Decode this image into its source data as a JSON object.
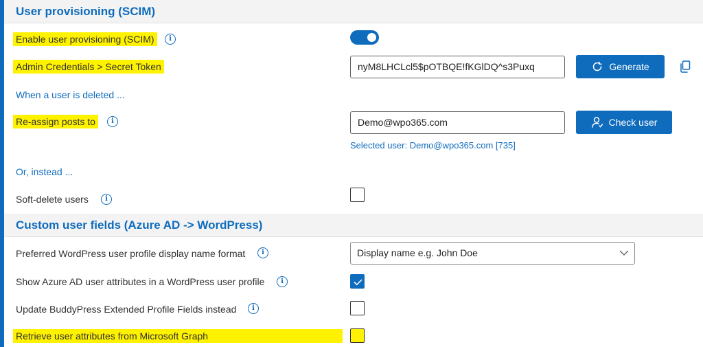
{
  "sections": {
    "scim": {
      "title": "User provisioning (SCIM)"
    },
    "custom_fields": {
      "title": "Custom user fields (Azure AD -> WordPress)"
    }
  },
  "rows": {
    "enable_scim": {
      "label": "Enable user provisioning (SCIM)",
      "value": true
    },
    "secret_token": {
      "label": "Admin Credentials > Secret Token",
      "value": "nyM8LHCLcl5$pOTBQE!fKGlDQ^s3Puxq",
      "button": "Generate"
    },
    "when_deleted": {
      "label": "When a user is deleted ..."
    },
    "reassign_posts": {
      "label": "Re-assign posts to",
      "value": "Demo@wpo365.com",
      "button": "Check user",
      "selected_user": "Selected user: Demo@wpo365.com [735]"
    },
    "or_instead": {
      "label": "Or, instead ..."
    },
    "soft_delete": {
      "label": "Soft-delete users",
      "checked": false
    },
    "display_name_format": {
      "label": "Preferred WordPress user profile display name format",
      "selected": "Display name e.g. John Doe"
    },
    "show_attributes": {
      "label": "Show Azure AD user attributes in a WordPress user profile",
      "checked": true
    },
    "update_buddypress": {
      "label": "Update BuddyPress Extended Profile Fields instead",
      "checked": false
    },
    "retrieve_graph": {
      "label": "Retrieve user attributes from Microsoft Graph",
      "checked": false
    }
  },
  "icons": {
    "info": "info-icon",
    "refresh": "refresh-icon",
    "user": "user-icon",
    "copy": "copy-icon",
    "chevron": "chevron-down-icon"
  },
  "colors": {
    "accent": "#0f6cbd",
    "highlight": "#fff200",
    "header_bg": "#f3f3f3"
  }
}
